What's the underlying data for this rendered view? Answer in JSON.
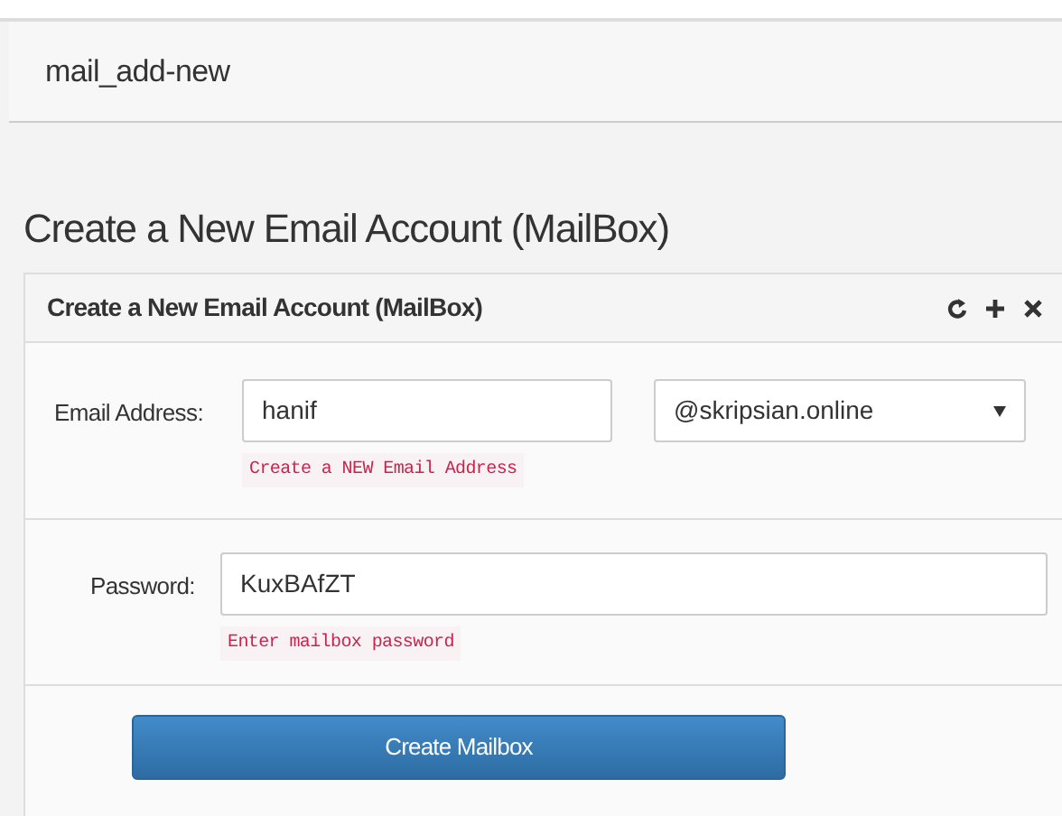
{
  "header": {
    "title": "mail_add-new"
  },
  "page_title": "Create a New Email Account (MailBox)",
  "panel": {
    "title": "Create a New Email Account (MailBox)",
    "tools": [
      {
        "kind": "refresh"
      },
      {
        "kind": "expand"
      },
      {
        "kind": "close"
      }
    ],
    "email": {
      "label": "Email Address:",
      "value": "hanif",
      "domain": "@skripsian.online",
      "hint": "Create a NEW Email Address"
    },
    "password": {
      "label": "Password:",
      "value": "KuxBAfZT",
      "hint": "Enter mailbox password"
    },
    "submit": "Create Mailbox"
  }
}
